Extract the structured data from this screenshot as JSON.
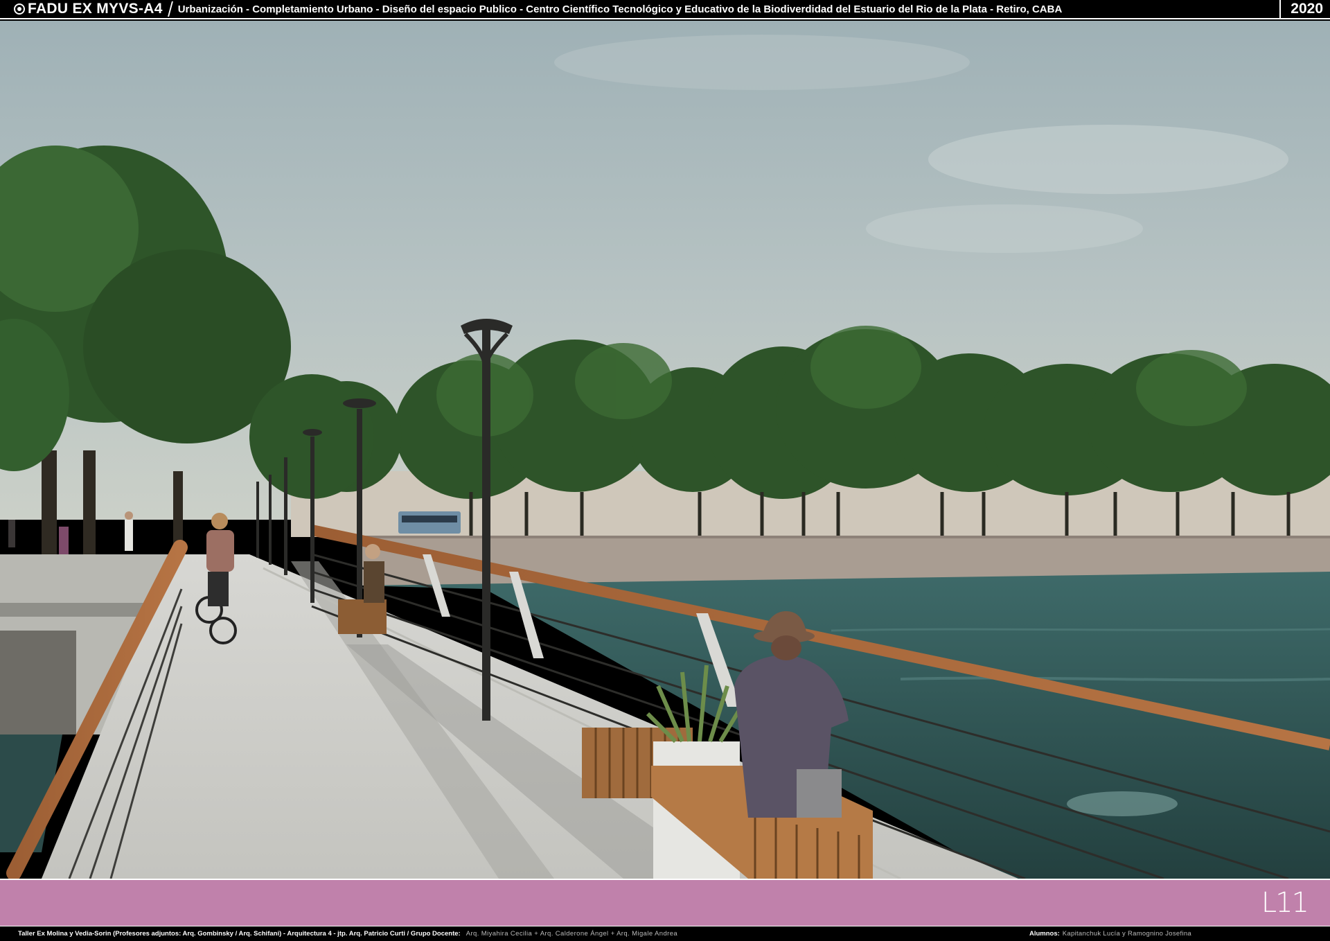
{
  "header": {
    "logo_icon": "university-seal-icon",
    "brand": "FADU EX MYVS-A4",
    "subtitle": "Urbanización - Completamiento Urbano - Diseño del espacio Publico - Centro Científico Tecnológico y Educativo de la Biodiverdidad del Estuario del Rio de la Plata   - Retiro, CABA",
    "year": "2020"
  },
  "render": {
    "description_icon": "waterfront-promenade-render-image",
    "sky_color": "#a9b8bd",
    "water_color": "#2f5554",
    "tree_color": "#2f5a2c"
  },
  "sheet_label": {
    "number": "L11",
    "band_color": "#c081ab"
  },
  "footer": {
    "credits": "Taller Ex Molina y Vedia-Sorin (Profesores adjuntos:  Arq. Gombinsky / Arq. Schifani) - Arquitectura 4 - jtp. Arq. Patricio Curti / Grupo Docente:",
    "team": "Arq. Miyahira Cecilia  +  Arq. Calderone Ángel  +  Arq. Migale Andrea",
    "students_label": "Alumnos:",
    "students": "Kapitanchuk Lucía  y  Ramognino Josefina"
  }
}
